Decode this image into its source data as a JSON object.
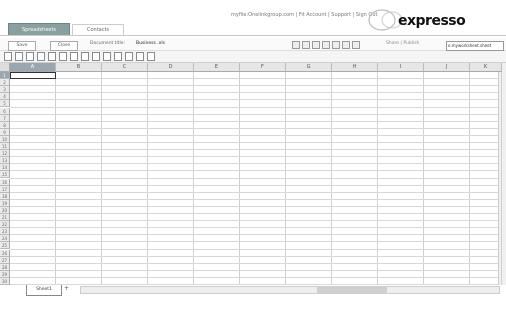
{
  "header": {
    "tabs": [
      {
        "label": "Spreadsheets",
        "active": true
      },
      {
        "label": "Contacts",
        "active": false
      }
    ],
    "user_info": "myfile:Onelinkgroup.com | Fit Account | Support | Sign Out",
    "logo": "expresso"
  },
  "toolbar": {
    "buttons": [
      {
        "label": "Save"
      },
      {
        "label": "Close"
      }
    ],
    "doc_label": "Document title:",
    "doc_value": "Business .xls",
    "links": "Share | Publish",
    "field_value": "e.myworksheet.sheet"
  },
  "grid": {
    "columns": [
      "A",
      "B",
      "C",
      "D",
      "E",
      "F",
      "G",
      "H",
      "I",
      "J",
      "K"
    ],
    "rows": [
      "1",
      "2",
      "3",
      "4",
      "5",
      "6",
      "7",
      "8",
      "9",
      "10",
      "11",
      "12",
      "13",
      "14",
      "15",
      "16",
      "17",
      "18",
      "19",
      "20",
      "21",
      "22",
      "23",
      "24",
      "25",
      "26",
      "27",
      "28",
      "29",
      "30"
    ],
    "active_cell": "A1"
  },
  "bottom": {
    "sheet_tab": "Sheet1",
    "add_sheet": "+"
  },
  "colors": {
    "active_tab": "#8aa0a0",
    "active_header": "#9aa7b0"
  }
}
